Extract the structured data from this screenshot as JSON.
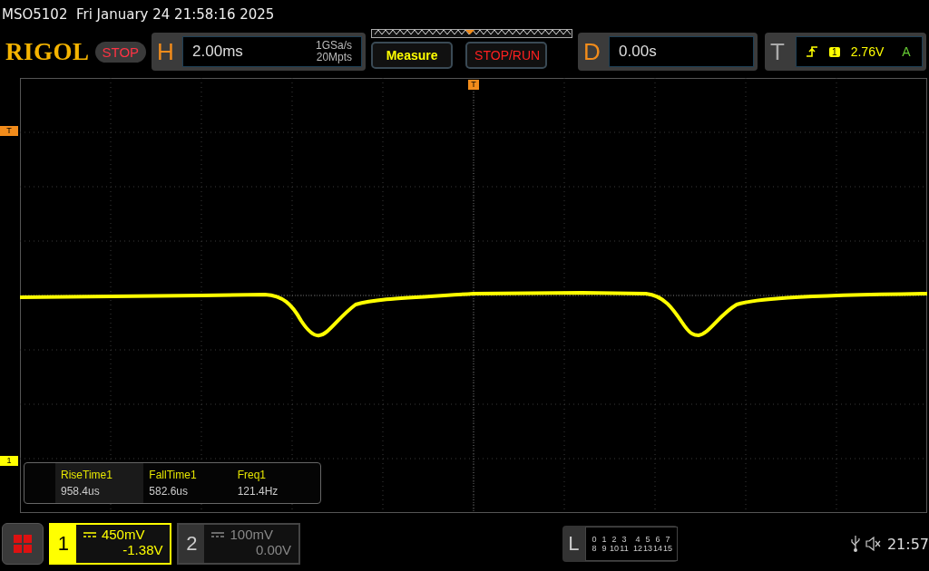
{
  "status_line": {
    "model": "MSO5102",
    "datetime": "Fri January 24 21:58:16 2025"
  },
  "logo": "RIGOL",
  "run_state": "STOP",
  "horizontal": {
    "label": "H",
    "timebase": "2.00ms",
    "sample_rate": "1GSa/s",
    "memory_depth": "20Mpts"
  },
  "buttons": [
    {
      "label": "Measure",
      "kind": "measure"
    },
    {
      "label": "STOP/RUN",
      "kind": "stoprun"
    }
  ],
  "delay": {
    "label": "D",
    "value": "0.00s"
  },
  "trigger": {
    "label": "T",
    "source": "1",
    "trigger_level": "2.76V",
    "mode": "A"
  },
  "markers": {
    "trigger_position": "T",
    "trigger_level": "T",
    "channel": "1"
  },
  "measurements": [
    {
      "name": "RiseTime1",
      "value": "958.4us"
    },
    {
      "name": "FallTime1",
      "value": "582.6us"
    },
    {
      "name": "Freq1",
      "value": "121.4Hz"
    }
  ],
  "channels": [
    {
      "number": "1",
      "scale": "450mV",
      "offset": "-1.38V",
      "selected": true
    },
    {
      "number": "2",
      "scale": "100mV",
      "offset": "0.00V",
      "selected": false
    }
  ],
  "logic": {
    "label": "L",
    "rows": [
      [
        "0",
        "1",
        "2",
        "3",
        "4",
        "5",
        "6",
        "7"
      ],
      [
        "8",
        "9",
        "10",
        "11",
        "12",
        "13",
        "14",
        "15"
      ]
    ]
  },
  "clock": "21:57"
}
